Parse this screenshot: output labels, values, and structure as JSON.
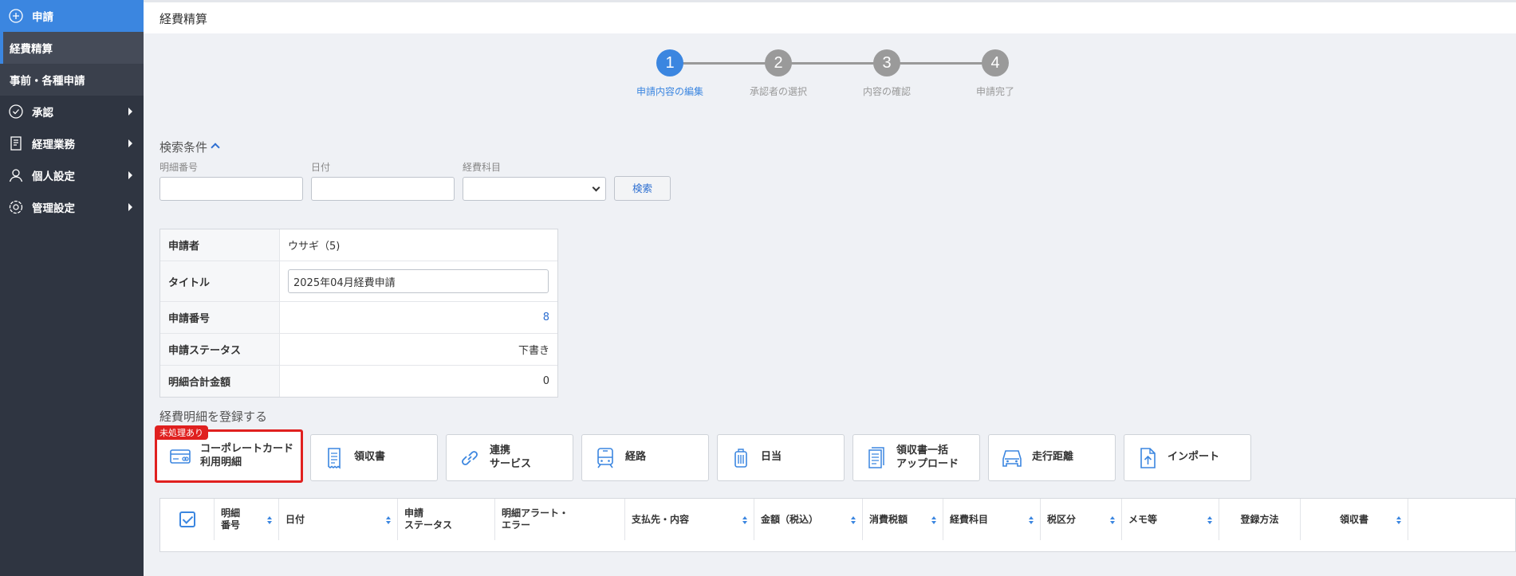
{
  "sidebar": {
    "items": [
      {
        "label": "申請",
        "icon": "plus-circle-icon"
      },
      {
        "label": "経費精算"
      },
      {
        "label": "事前・各種申請"
      },
      {
        "label": "承認",
        "icon": "check-circle-icon"
      },
      {
        "label": "経理業務",
        "icon": "document-icon"
      },
      {
        "label": "個人設定",
        "icon": "person-icon"
      },
      {
        "label": "管理設定",
        "icon": "gear-icon"
      }
    ]
  },
  "header": {
    "title": "経費精算"
  },
  "steps": [
    {
      "number": "1",
      "label": "申請内容の編集",
      "active": true
    },
    {
      "number": "2",
      "label": "承認者の選択",
      "active": false
    },
    {
      "number": "3",
      "label": "内容の確認",
      "active": false
    },
    {
      "number": "4",
      "label": "申請完了",
      "active": false
    }
  ],
  "search": {
    "title": "検索条件",
    "fields": {
      "detail_number": {
        "label": "明細番号",
        "value": ""
      },
      "date": {
        "label": "日付",
        "value": ""
      },
      "account": {
        "label": "経費科目",
        "value": ""
      }
    },
    "button": "検索"
  },
  "info": {
    "rows": [
      {
        "key": "申請者",
        "value": "ウサギ（5)"
      },
      {
        "key": "タイトル",
        "value": "2025年04月経費申請"
      },
      {
        "key": "申請番号",
        "value": "8"
      },
      {
        "key": "申請ステータス",
        "value": "下書き"
      },
      {
        "key": "明細合計金額",
        "value": "0"
      }
    ]
  },
  "register": {
    "title": "経費明細を登録する",
    "buttons": [
      {
        "label": "コーポレートカード\n利用明細",
        "icon": "credit-card-icon",
        "badge": "未処理あり"
      },
      {
        "label": "領収書",
        "icon": "receipt-icon"
      },
      {
        "label": "連携\nサービス",
        "icon": "link-icon"
      },
      {
        "label": "経路",
        "icon": "train-icon"
      },
      {
        "label": "日当",
        "icon": "suitcase-icon"
      },
      {
        "label": "領収書一括\nアップロード",
        "icon": "bulk-receipt-icon"
      },
      {
        "label": "走行距離",
        "icon": "car-icon"
      },
      {
        "label": "インポート",
        "icon": "file-upload-icon"
      }
    ]
  },
  "table": {
    "columns": [
      {
        "label": "明細\n番号"
      },
      {
        "label": "日付"
      },
      {
        "label": "申請\nステータス"
      },
      {
        "label": "明細アラート・\nエラー"
      },
      {
        "label": "支払先・内容"
      },
      {
        "label": "金額（税込）"
      },
      {
        "label": "消費税額"
      },
      {
        "label": "経費科目"
      },
      {
        "label": "税区分"
      },
      {
        "label": "メモ等"
      },
      {
        "label": "登録方法"
      },
      {
        "label": "領収書"
      }
    ]
  },
  "colors": {
    "accent": "#3b86e0",
    "sidebar": "#2f3541",
    "highlight": "#e0201f"
  }
}
